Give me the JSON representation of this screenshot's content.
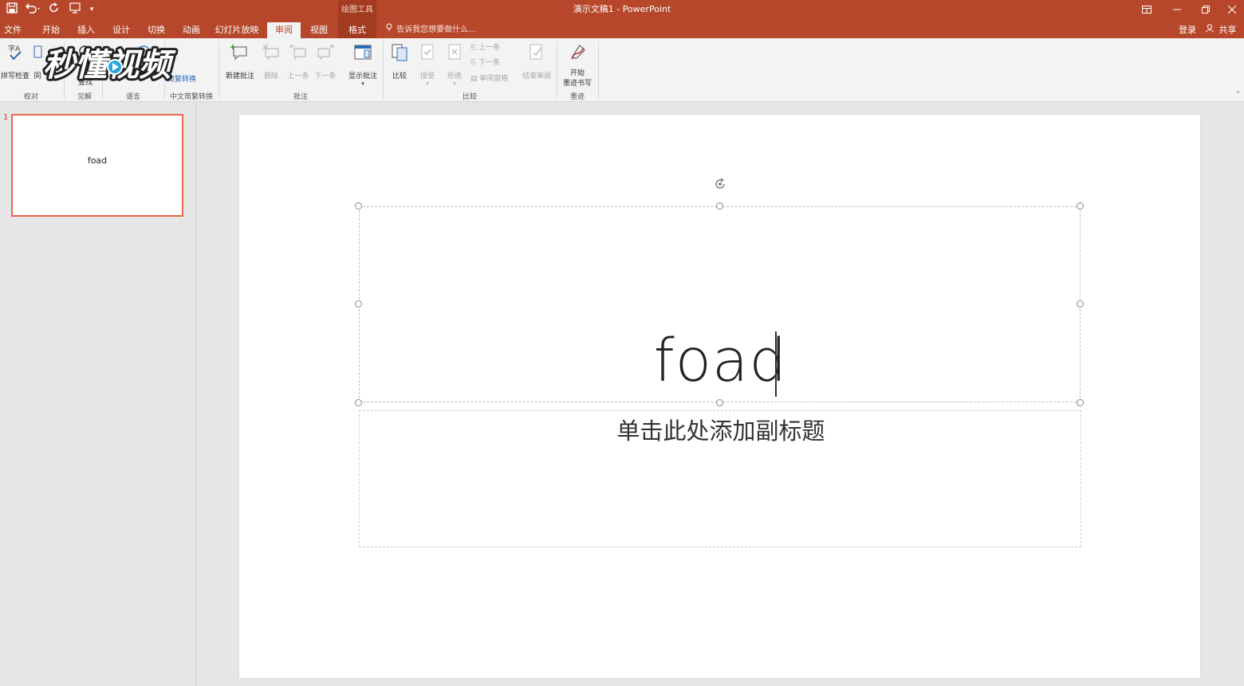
{
  "app": {
    "window_title": "演示文稿1 - PowerPoint",
    "context_group": "绘图工具"
  },
  "quick_access": {
    "save": "save-icon",
    "undo": "undo-icon",
    "redo": "redo-icon",
    "customize": "▾"
  },
  "tabs": [
    {
      "label": "文件",
      "active": false
    },
    {
      "label": "开始",
      "active": false
    },
    {
      "label": "插入",
      "active": false
    },
    {
      "label": "设计",
      "active": false
    },
    {
      "label": "切换",
      "active": false
    },
    {
      "label": "动画",
      "active": false
    },
    {
      "label": "幻灯片放映",
      "active": false
    },
    {
      "label": "审阅",
      "active": true
    },
    {
      "label": "视图",
      "active": false
    },
    {
      "label": "格式",
      "active": false
    }
  ],
  "tell_me": "告诉我您想要做什么...",
  "account": {
    "signin": "登录",
    "share": "共享"
  },
  "ribbon": {
    "spelling": "拼写检查",
    "thesaurus_partial": "同",
    "smart_lookup": "查找",
    "chinese_conv": "简繁转换",
    "new_comment": "新建批注",
    "delete": "删除",
    "previous": "上一条",
    "next": "下一条",
    "show_comments": "显示批注",
    "compare": "比较",
    "accept": "接受",
    "reject": "拒绝",
    "prev_change": "上一条",
    "next_change": "下一条",
    "review_pane": "审阅窗格",
    "end_review": "结束审阅",
    "start_inking_1": "开始",
    "start_inking_2": "墨迹书写",
    "groups": {
      "proofing": "校对",
      "insights": "见解",
      "language": "语言",
      "chinese": "中文简繁转换",
      "comments": "批注",
      "compare": "比较",
      "ink": "墨迹"
    }
  },
  "watermark": "秒懂视频",
  "thumbnail": {
    "number": "1",
    "title": "foad"
  },
  "slide": {
    "title": "foad",
    "subtitle_placeholder": "单击此处添加副标题"
  },
  "colors": {
    "accent": "#b7472a",
    "thumbnail_border": "#e8664a"
  }
}
